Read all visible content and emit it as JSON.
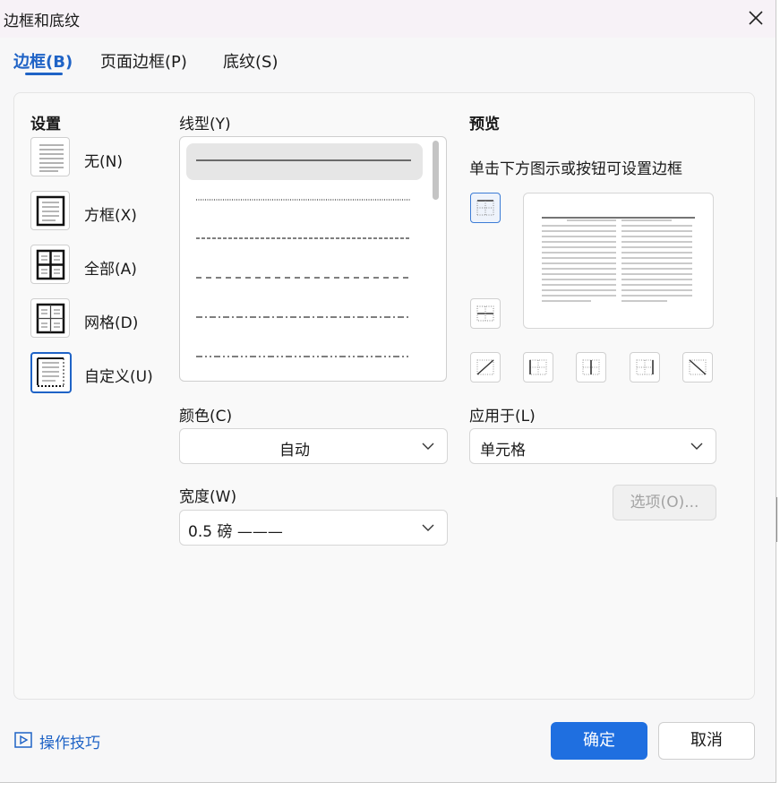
{
  "window": {
    "title": "边框和底纹"
  },
  "tabs": [
    {
      "label": "边框(B)",
      "active": true
    },
    {
      "label": "页面边框(P)",
      "active": false
    },
    {
      "label": "底纹(S)",
      "active": false
    }
  ],
  "settings": {
    "heading": "设置",
    "items": [
      {
        "label": "无(N)",
        "icon": "none-border-icon"
      },
      {
        "label": "方框(X)",
        "icon": "box-border-icon"
      },
      {
        "label": "全部(A)",
        "icon": "all-border-icon"
      },
      {
        "label": "网格(D)",
        "icon": "grid-border-icon"
      },
      {
        "label": "自定义(U)",
        "icon": "custom-border-icon",
        "selected": true
      }
    ]
  },
  "line_style": {
    "label": "线型(Y)",
    "styles": [
      "solid",
      "dotted",
      "dashed-fine",
      "dashed",
      "dash-dot",
      "dash-dot-dot"
    ],
    "selected": "solid"
  },
  "color": {
    "label": "颜色(C)",
    "value": "自动"
  },
  "width": {
    "label": "宽度(W)",
    "value": "0.5 磅 ———"
  },
  "preview": {
    "heading": "预览",
    "hint": "单击下方图示或按钮可设置边框"
  },
  "apply_to": {
    "label": "应用于(L)",
    "value": "单元格"
  },
  "options_button": "选项(O)...",
  "footer": {
    "tips": "操作技巧",
    "ok": "确定",
    "cancel": "取消"
  },
  "colors": {
    "accent": "#1f63c6",
    "primary_button": "#1f6fe0"
  }
}
